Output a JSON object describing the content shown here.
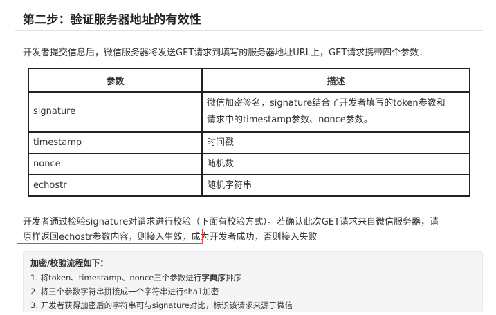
{
  "heading": "第二步：验证服务器地址的有效性",
  "intro": "开发者提交信息后，微信服务器将发送GET请求到填写的服务器地址URL上，GET请求携带四个参数：",
  "table": {
    "headers": [
      "参数",
      "描述"
    ],
    "rows": [
      {
        "param": "signature",
        "desc_line1": "微信加密签名，signature结合了开发者填写的token参数和",
        "desc_line2": "请求中的timestamp参数、nonce参数。"
      },
      {
        "param": "timestamp",
        "desc": "时间戳"
      },
      {
        "param": "nonce",
        "desc": "随机数"
      },
      {
        "param": "echostr",
        "desc": "随机字符串"
      }
    ]
  },
  "paragraph": {
    "line1": "开发者通过检验signature对请求进行校验（下面有校验方式）。若确认此次GET请求来自微信服务器，请",
    "line2": "原样返回echostr参数内容，则接入生效，成为开发者成功，否则接入失败。"
  },
  "process_box": {
    "title": "加密/校验流程如下：",
    "step1_pre": "1. 将token、timestamp、nonce三个参数进行",
    "step1_bold": "字典序",
    "step1_post": "排序",
    "step2": "2. 将三个参数字符串拼接成一个字符串进行sha1加密",
    "step3": "3. 开发者获得加密后的字符串可与signature对比，标识该请求来源于微信"
  },
  "colors": {
    "highlight_border": "#e0463b",
    "box_background": "#f5f5f5"
  }
}
